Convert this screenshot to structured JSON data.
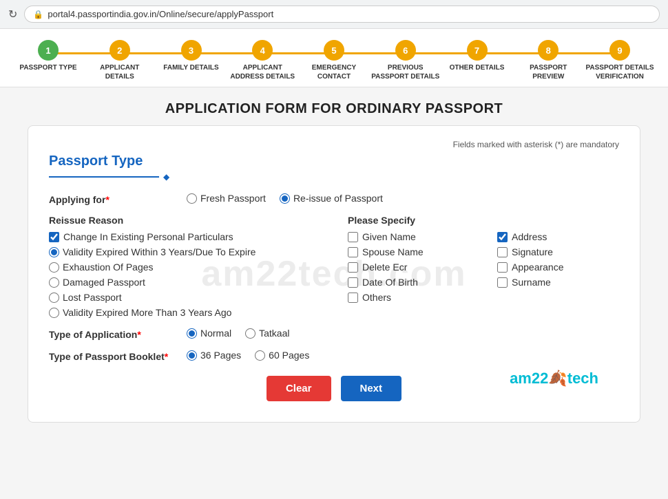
{
  "browser": {
    "url": "portal4.passportindia.gov.in/Online/secure/applyPassport",
    "refresh_icon": "↻",
    "lock_icon": "🔒"
  },
  "progress": {
    "steps": [
      {
        "number": "1",
        "label": "PASSPORT TYPE",
        "status": "active"
      },
      {
        "number": "2",
        "label": "APPLICANT DETAILS",
        "status": "inactive"
      },
      {
        "number": "3",
        "label": "FAMILY DETAILS",
        "status": "inactive"
      },
      {
        "number": "4",
        "label": "APPLICANT ADDRESS DETAILS",
        "status": "inactive"
      },
      {
        "number": "5",
        "label": "EMERGENCY CONTACT",
        "status": "inactive"
      },
      {
        "number": "6",
        "label": "PREVIOUS PASSPORT DETAILS",
        "status": "inactive"
      },
      {
        "number": "7",
        "label": "OTHER DETAILS",
        "status": "inactive"
      },
      {
        "number": "8",
        "label": "PASSPORT PREVIEW",
        "status": "inactive"
      },
      {
        "number": "9",
        "label": "PASSPORT DETAILS VERIFICATION",
        "status": "inactive"
      }
    ]
  },
  "page": {
    "title": "APPLICATION FORM FOR ORDINARY PASSPORT"
  },
  "form": {
    "mandatory_note": "Fields marked with asterisk (*) are mandatory",
    "section_title": "Passport Type",
    "applying_for_label": "Applying for",
    "applying_for_options": [
      {
        "value": "fresh",
        "label": "Fresh Passport"
      },
      {
        "value": "reissue",
        "label": "Re-issue of Passport"
      }
    ],
    "applying_for_selected": "reissue",
    "reissue_reason_label": "Reissue Reason",
    "reissue_reasons": [
      {
        "value": "change_personal",
        "label": "Change In Existing Personal Particulars",
        "checked": true,
        "type": "checkbox"
      },
      {
        "value": "validity_expired",
        "label": "Validity Expired Within 3 Years/Due To Expire",
        "checked": true,
        "type": "radio"
      },
      {
        "value": "exhaustion",
        "label": "Exhaustion Of Pages",
        "checked": false,
        "type": "radio"
      },
      {
        "value": "damaged",
        "label": "Damaged Passport",
        "checked": false,
        "type": "radio"
      },
      {
        "value": "lost",
        "label": "Lost Passport",
        "checked": false,
        "type": "radio"
      },
      {
        "value": "validity_expired_3",
        "label": "Validity Expired More Than 3 Years Ago",
        "checked": false,
        "type": "radio"
      }
    ],
    "please_specify_label": "Please Specify",
    "please_specify_options": [
      {
        "value": "given_name",
        "label": "Given Name",
        "checked": false,
        "col": 1
      },
      {
        "value": "address",
        "label": "Address",
        "checked": true,
        "col": 2
      },
      {
        "value": "spouse_name",
        "label": "Spouse Name",
        "checked": false,
        "col": 1
      },
      {
        "value": "signature",
        "label": "Signature",
        "checked": false,
        "col": 2
      },
      {
        "value": "delete_ecr",
        "label": "Delete Ecr",
        "checked": false,
        "col": 1
      },
      {
        "value": "appearance",
        "label": "Appearance",
        "checked": false,
        "col": 2
      },
      {
        "value": "date_of_birth",
        "label": "Date Of Birth",
        "checked": false,
        "col": 1
      },
      {
        "value": "surname",
        "label": "Surname",
        "checked": false,
        "col": 2
      },
      {
        "value": "others",
        "label": "Others",
        "checked": false,
        "col": 1
      }
    ],
    "application_type_label": "Type of Application",
    "application_type_options": [
      {
        "value": "normal",
        "label": "Normal"
      },
      {
        "value": "tatkaal",
        "label": "Tatkaal"
      }
    ],
    "application_type_selected": "normal",
    "passport_booklet_label": "Type of Passport Booklet",
    "passport_booklet_options": [
      {
        "value": "36",
        "label": "36 Pages"
      },
      {
        "value": "60",
        "label": "60 Pages"
      }
    ],
    "passport_booklet_selected": "36",
    "buttons": {
      "clear": "Clear",
      "next": "Next"
    }
  },
  "branding": {
    "text_1": "am22",
    "leaf": "🍂",
    "text_2": "tech"
  },
  "watermark": "am22tech.com"
}
